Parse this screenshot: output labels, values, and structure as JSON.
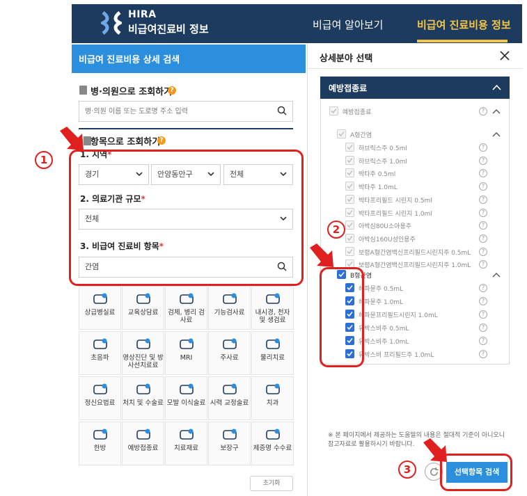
{
  "header": {
    "brand_top": "HIRA",
    "brand_bottom": "비급여진료비 정보",
    "nav": [
      "비급여 알아보기",
      "비급여 진료비용 정보"
    ]
  },
  "left": {
    "title": "비급여 진료비용 상세 검색",
    "hospital_section": {
      "heading": "병·의원으로 조회하기",
      "placeholder": "병·의원 이름 또는 도로명 주소 입력"
    },
    "item_section": {
      "heading": "항목으로 조회하기",
      "region_label": "1. 지역",
      "region_values": [
        "경기",
        "안양동안구",
        "전체"
      ],
      "size_label": "2. 의료기관 규모",
      "size_value": "전체",
      "item_label": "3. 비급여 진료비 항목",
      "item_value": "간염",
      "required_mark": "*"
    },
    "categories": [
      [
        "상급병실료",
        "교육상담료",
        "검체, 병리 검사료",
        "기능검사료",
        "내시경, 천자 및 생검료"
      ],
      [
        "초음파",
        "영상진단 및 방사선치료료",
        "MRI",
        "주사료",
        "물리치료"
      ],
      [
        "정신요법료",
        "처치 및 수술료",
        "모발 이식술료",
        "시력 교정술료",
        "치과"
      ],
      [
        "한방",
        "예방접종료",
        "치료재료",
        "보장구",
        "제증명 수수료"
      ]
    ],
    "reset_label": "초기화"
  },
  "right": {
    "title": "상세분야 선택",
    "accordion_label": "예방접종료",
    "root_item": "예방접종료",
    "group_a": {
      "label": "A형간염",
      "items": [
        "하브릭스주 0.5ml",
        "하브릭스주 1.0ml",
        "박타주 0.5ml",
        "박타주 1.0mL",
        "박타프리필드 시린지 0.5ml",
        "박타프리필드 시린지 1.0ml",
        "아박심80U소아용주",
        "아박심160U성인용주",
        "보령A형간염백신프리필드시린지주 0.5mL",
        "보령A형간염백신프리필드시린지주 1.0mL"
      ]
    },
    "group_b": {
      "label": "B형간염",
      "items": [
        "헤파뮨주 0.5mL",
        "헤파뮨주 1.0mL",
        "헤파뮨프리필드시린지 1.0mL",
        "유박스비주 0.5mL",
        "유박스비주 1.0mL",
        "유박스비 프리필드주 1.0mL"
      ]
    },
    "help_glyph": "?",
    "notice": "※ 본 페이지에서 제공하는 도움말의 내용은 절대적 기준이 아니오니 참고자료로 활용하시기 바랍니다.",
    "search_button": "선택항목 검색"
  },
  "annotations": [
    "1",
    "2",
    "3"
  ],
  "colors": {
    "header": "#1d3b5e",
    "accent_blue": "#2b8fde",
    "highlight": "#e0201f",
    "nav_active": "#f6c646"
  }
}
